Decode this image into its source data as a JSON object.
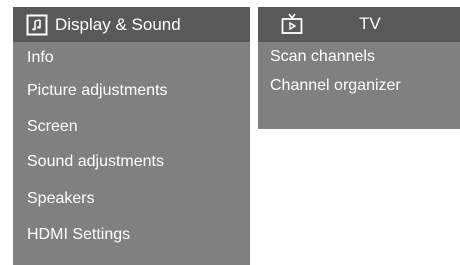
{
  "left_menu": {
    "title": "Display & Sound",
    "icon": "display-sound-icon",
    "items": [
      {
        "label": "Info"
      },
      {
        "label": "Picture adjustments"
      },
      {
        "label": "Screen"
      },
      {
        "label": "Sound adjustments"
      },
      {
        "label": "Speakers"
      },
      {
        "label": "HDMI Settings"
      }
    ]
  },
  "right_menu": {
    "title": "TV",
    "icon": "tv-icon",
    "items": [
      {
        "label": "Scan channels"
      },
      {
        "label": "Channel organizer"
      }
    ]
  },
  "colors": {
    "panel_bg": "#808080",
    "header_bg": "#595959",
    "text": "#ffffff"
  }
}
